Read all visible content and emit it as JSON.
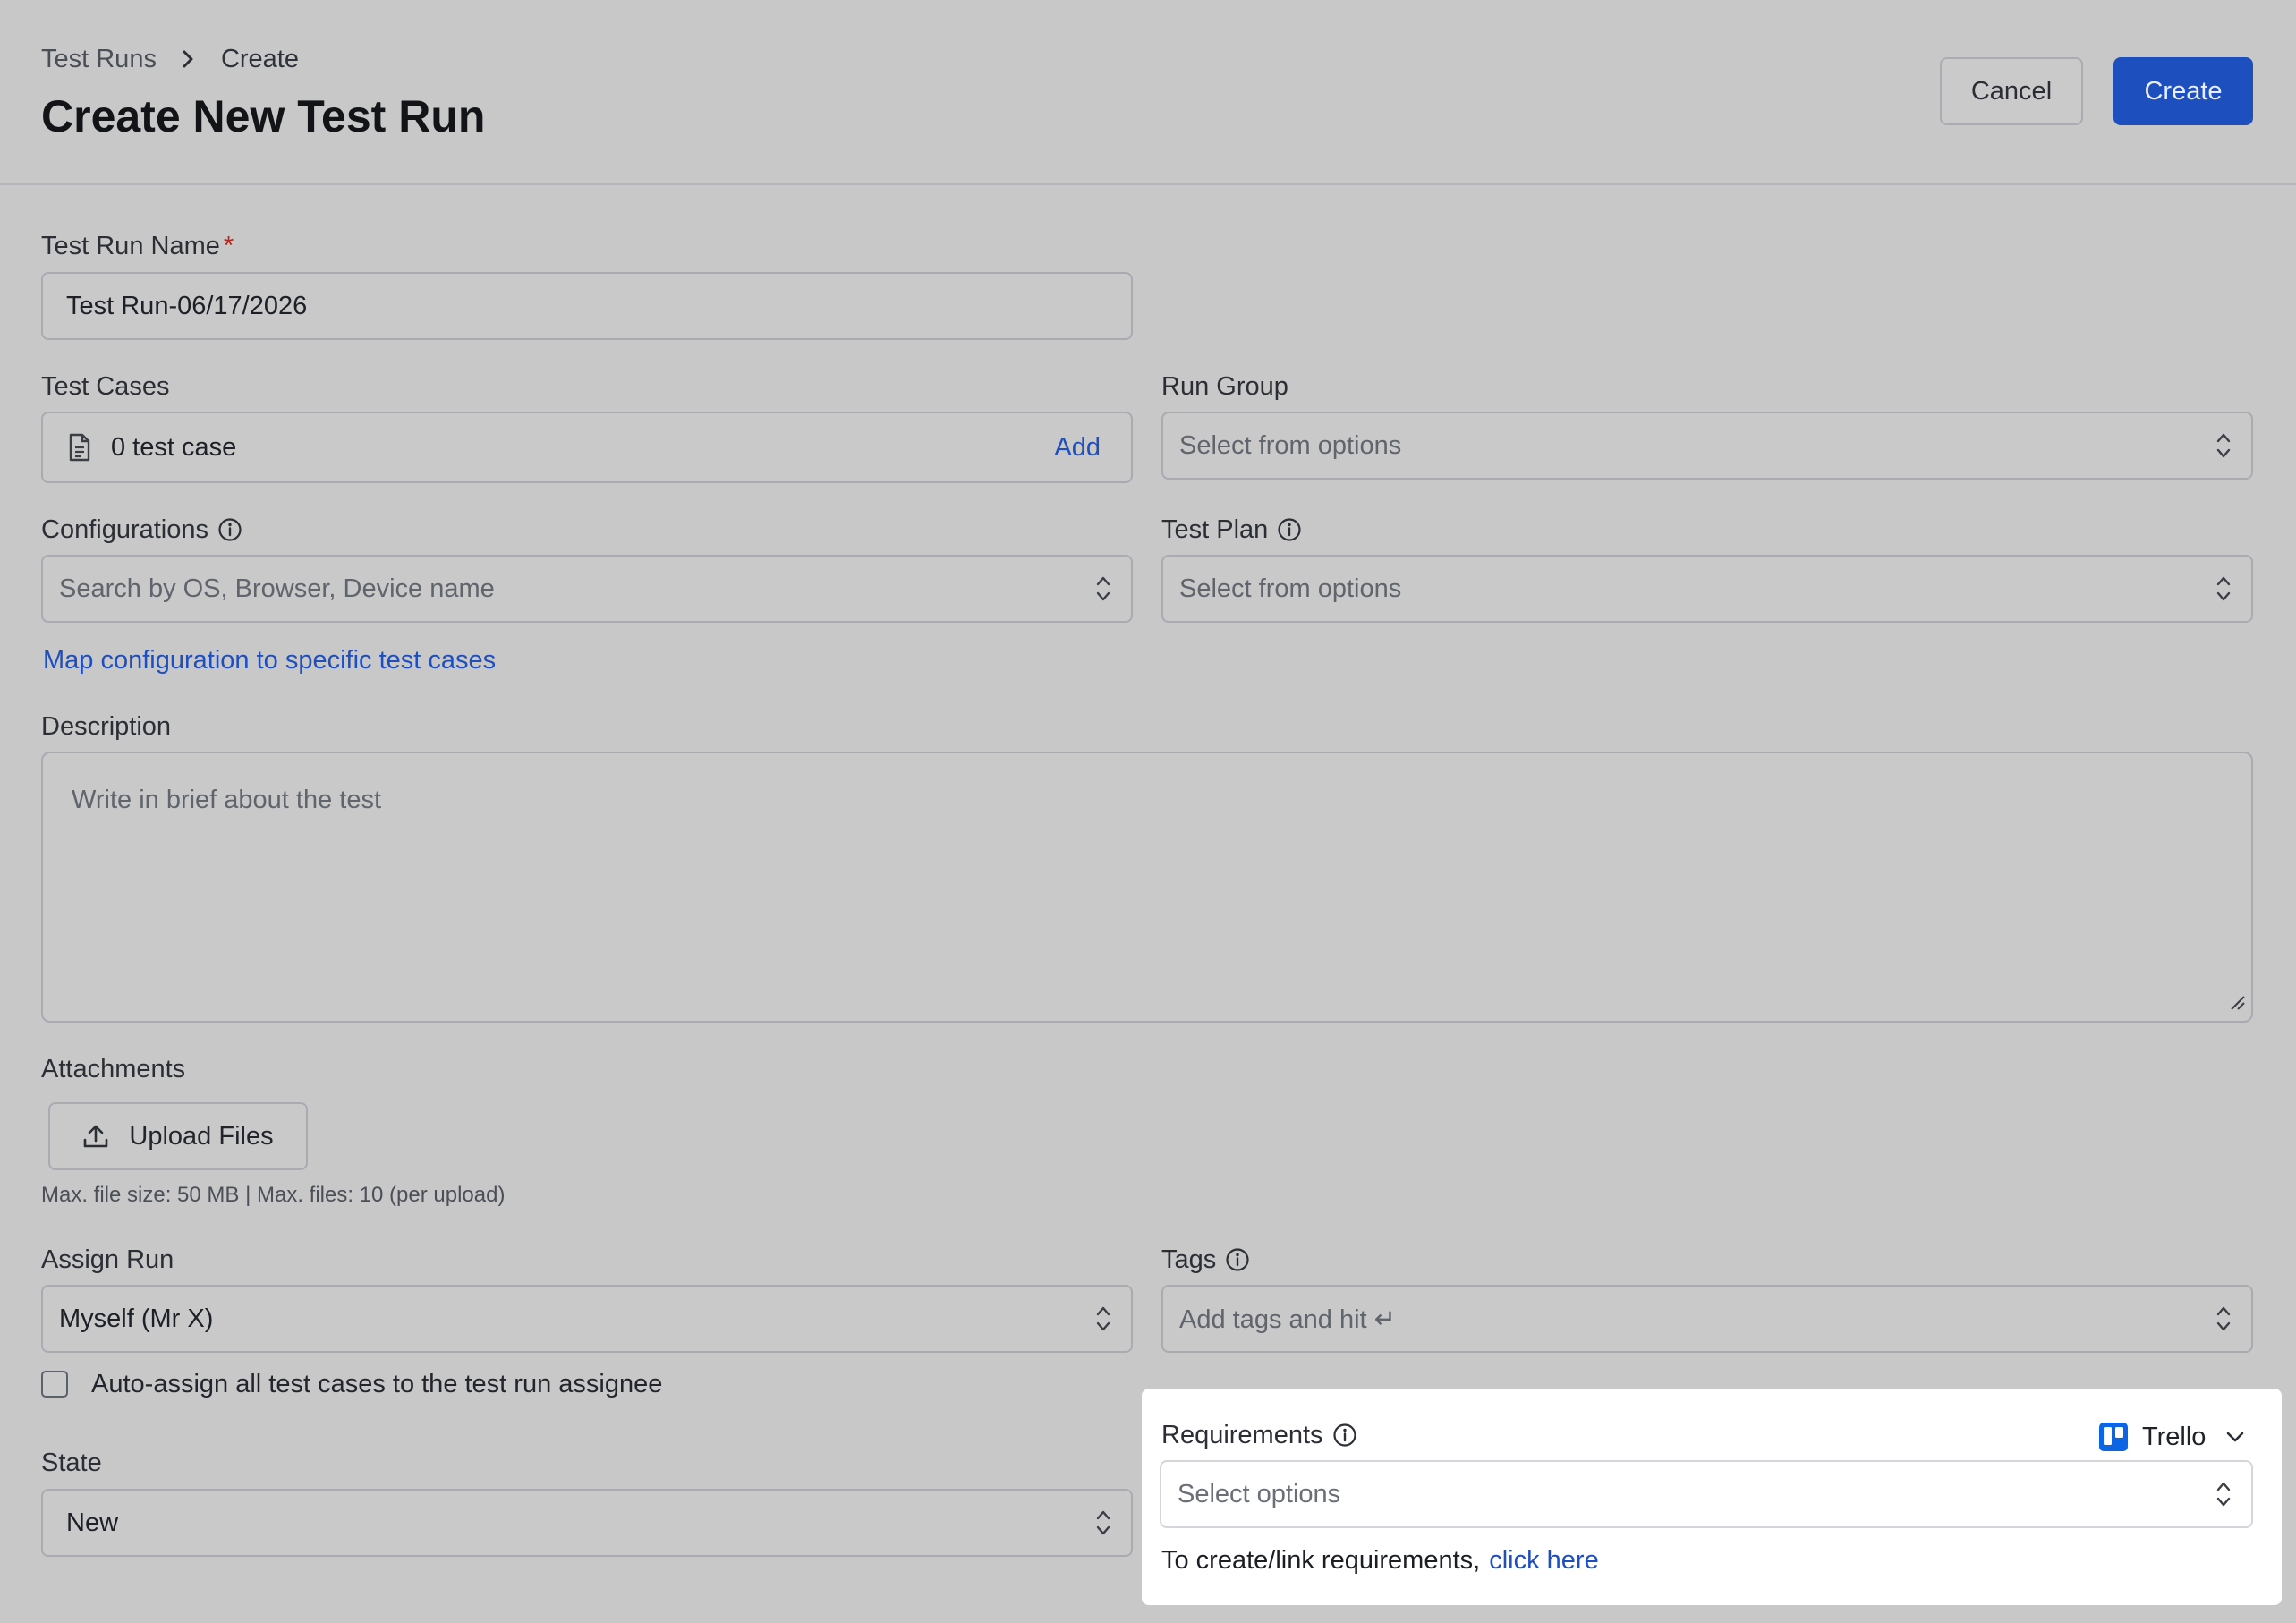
{
  "header": {
    "breadcrumb": {
      "parent": "Test Runs",
      "current": "Create"
    },
    "title": "Create New Test Run",
    "cancel_label": "Cancel",
    "create_label": "Create"
  },
  "form": {
    "test_run_name": {
      "label": "Test Run Name",
      "required_mark": "*",
      "value": "Test Run-06/17/2026"
    },
    "test_cases": {
      "label": "Test Cases",
      "value": "0 test case",
      "add_label": "Add"
    },
    "run_group": {
      "label": "Run Group",
      "placeholder": "Select from options"
    },
    "configurations": {
      "label": "Configurations",
      "placeholder": "Search by OS, Browser, Device name"
    },
    "test_plan": {
      "label": "Test Plan",
      "placeholder": "Select from options"
    },
    "map_config_link": "Map configuration to specific test cases",
    "description": {
      "label": "Description",
      "placeholder": "Write in brief about the test"
    },
    "attachments": {
      "label": "Attachments",
      "upload_label": "Upload Files",
      "hint": "Max. file size: 50 MB | Max. files: 10 (per upload)"
    },
    "assign_run": {
      "label": "Assign Run",
      "value": "Myself (Mr X)"
    },
    "tags": {
      "label": "Tags",
      "placeholder": "Add tags and hit ↵"
    },
    "auto_assign": {
      "label": "Auto-assign all test cases to the test run assignee",
      "checked": false
    },
    "state": {
      "label": "State",
      "value": "New"
    },
    "requirements": {
      "label": "Requirements",
      "provider": "Trello",
      "placeholder": "Select options",
      "helper_text": "To create/link requirements,",
      "helper_link": "click here"
    }
  },
  "colors": {
    "primary": "#1d4fbf",
    "link": "#1f4fbf",
    "required": "#b3261e",
    "trello": "#0c66e4",
    "overlay_bg": "#c8c8c8"
  },
  "icons": [
    "chevron-right-icon",
    "document-icon",
    "info-icon",
    "chevron-updown-icon",
    "upload-icon",
    "resize-grip-icon",
    "trello-icon",
    "chevron-down-icon"
  ]
}
